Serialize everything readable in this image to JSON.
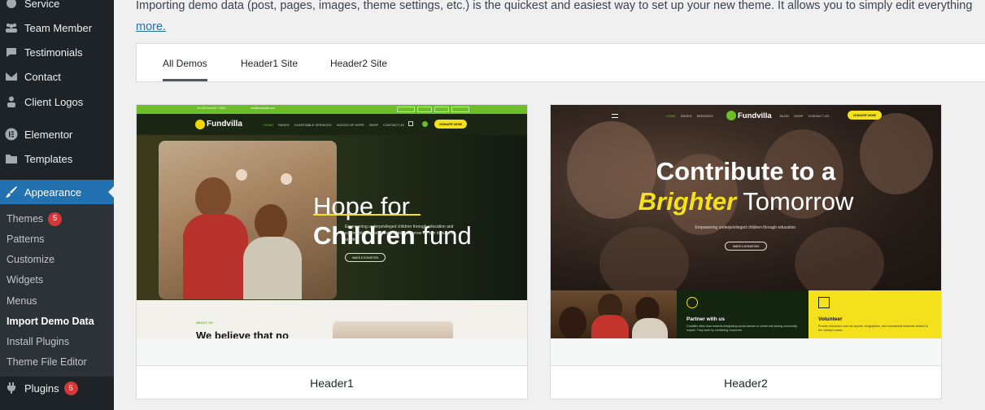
{
  "sidebar": {
    "items": [
      {
        "label": "Service",
        "icon": "service-icon"
      },
      {
        "label": "Team Member",
        "icon": "team-icon"
      },
      {
        "label": "Testimonials",
        "icon": "testimonials-icon"
      },
      {
        "label": "Contact",
        "icon": "contact-icon"
      },
      {
        "label": "Client Logos",
        "icon": "client-logos-icon"
      },
      {
        "label": "Elementor",
        "icon": "elementor-icon"
      },
      {
        "label": "Templates",
        "icon": "folder-icon"
      },
      {
        "label": "Appearance",
        "icon": "brush-icon"
      },
      {
        "label": "Plugins",
        "icon": "plugin-icon",
        "badge": "5"
      }
    ],
    "submenu": [
      {
        "label": "Themes",
        "badge": "5"
      },
      {
        "label": "Patterns"
      },
      {
        "label": "Customize"
      },
      {
        "label": "Widgets"
      },
      {
        "label": "Menus"
      },
      {
        "label": "Import Demo Data"
      },
      {
        "label": "Install Plugins"
      },
      {
        "label": "Theme File Editor"
      }
    ]
  },
  "intro": {
    "text": "Importing demo data (post, pages, images, theme settings, etc.) is the quickest and easiest way to set up your new theme. It allows you to simply edit everything",
    "more_link": "more."
  },
  "tabs": [
    "All Demos",
    "Header1 Site",
    "Header2 Site"
  ],
  "demos": [
    {
      "name": "Header1",
      "preview": {
        "topbar_address": "24 Old Road,NY 10001",
        "topbar_email": "info@example.com",
        "topbar_links": [
          "Facebook",
          "Twitter",
          "Linkedin",
          "Instagram"
        ],
        "logo": "Fundvilla",
        "nav": [
          "HOME",
          "PAGES",
          "CHARITABLE SERVICES",
          "VOICES OF HOPE",
          "SHOP",
          "CONTACT US"
        ],
        "cta": "DONATE NOW",
        "headline_line1": "Hope for",
        "headline_bold": "Children",
        "headline_rest": " fund",
        "subtext": "Empowering underprivileged children through education and community support for a brighter tomorrow we aim to build a brighter.",
        "button": "MAKE A DONATION",
        "about_label": "ABOUT US",
        "about_heading": "We believe that no"
      }
    },
    {
      "name": "Header2",
      "preview": {
        "logo": "Fundvilla",
        "nav_left": [
          "HOME",
          "PAGES",
          "SERVICES"
        ],
        "nav_right": [
          "BLOG",
          "SHOP",
          "CONTACT US"
        ],
        "cta": "DONATE NOW",
        "headline_line1": "Contribute to a",
        "headline_highlight": "Brighter",
        "headline_rest": " Tomorrow",
        "subtext": "Empowering underprivileged children through education.",
        "button": "MAKE A DONATION",
        "block1_title": "Partner with us",
        "block1_text": "Charities often lean towards integrating social causes to create this lasting community impact. They work by combining resources",
        "block2_title": "Volunteer",
        "block2_text": "Provide resources such as reports, infographics, and educational materials related to the charity's cause"
      }
    }
  ]
}
